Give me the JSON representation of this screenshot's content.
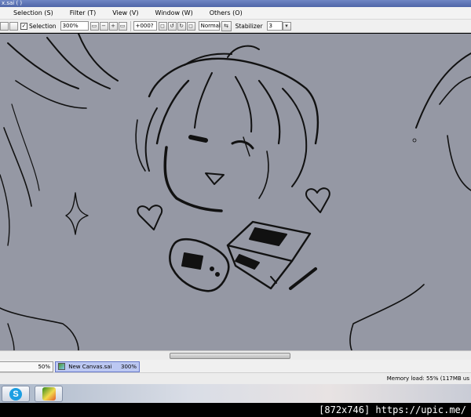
{
  "window": {
    "title": "x.sai ( )"
  },
  "menu": {
    "items": [
      {
        "label": "Selection (S)"
      },
      {
        "label": "Filter (T)"
      },
      {
        "label": "View (V)"
      },
      {
        "label": "Window (W)"
      },
      {
        "label": "Others (O)"
      }
    ]
  },
  "toolbar": {
    "selection_label": "Selection",
    "selection_checked": true,
    "zoom": "300%",
    "rotation": "+000?",
    "blend_mode": "Normal",
    "stabilizer_label": "Stabilizer",
    "stabilizer_value": "3"
  },
  "tabs": {
    "items": [
      {
        "label": "",
        "zoom": "50%",
        "active": false
      },
      {
        "label": "New Canvas.sai",
        "zoom": "300%",
        "active": true
      }
    ]
  },
  "status": {
    "memory": "Memory load: 55% (117MB us"
  },
  "taskbar": {
    "apps": [
      {
        "name": "skype-icon",
        "glyph": "S"
      },
      {
        "name": "paint-tool-sai-icon",
        "glyph": ""
      }
    ]
  },
  "watermark": {
    "text": "[872x746] https://upic.me/"
  },
  "colors": {
    "canvas": "#9598a4",
    "tab_active": "#bcc8f2",
    "skype": "#1b9ee2"
  }
}
